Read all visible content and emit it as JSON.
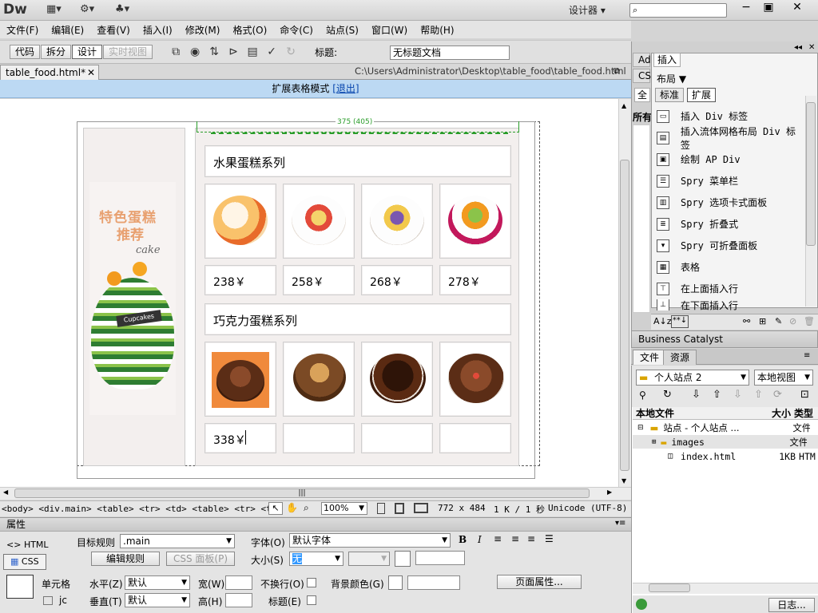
{
  "app": {
    "logo": "Dw",
    "workspace": "设计器",
    "window_buttons": [
      "−",
      "▣",
      "✕"
    ]
  },
  "menu": [
    "文件(F)",
    "编辑(E)",
    "查看(V)",
    "插入(I)",
    "修改(M)",
    "格式(O)",
    "命令(C)",
    "站点(S)",
    "窗口(W)",
    "帮助(H)"
  ],
  "toolbar": {
    "views": [
      "代码",
      "拆分",
      "设计",
      "实时视图"
    ],
    "title_label": "标题:",
    "title_value": "无标题文档"
  },
  "document": {
    "tab_name": "table_food.html*",
    "path": "C:\\Users\\Administrator\\Desktop\\table_food\\table_food.html",
    "expanded_mode_text": "扩展表格模式",
    "exit_link": "[退出]",
    "width_marker": "375 (405)"
  },
  "page": {
    "banner_line1": "特色蛋糕",
    "banner_line2": "推荐",
    "banner_en": "cake",
    "section1_title": "水果蛋糕系列",
    "section1_prices": [
      "238￥",
      "258￥",
      "268￥",
      "278￥"
    ],
    "section2_title": "巧克力蛋糕系列",
    "section2_prices": [
      "338￥",
      "",
      "",
      ""
    ],
    "cake_label": "Cupcakes"
  },
  "statusbar": {
    "tags": "<body> <div.main> <table> <tr> <td> <table> <tr> <td>",
    "zoom": "100%",
    "size": "772 x 484",
    "filesize": "1 K / 1 秒",
    "encoding": "Unicode (UTF-8)"
  },
  "properties": {
    "title": "属性",
    "html_label": "HTML",
    "css_label": "CSS",
    "target_rule_label": "目标规则",
    "target_rule_value": ".main",
    "edit_rule_btn": "编辑规则",
    "css_panel_btn": "CSS 面板(P)",
    "font_label": "字体(O)",
    "font_value": "默认字体",
    "size_label": "大小(S)",
    "size_value": "无",
    "bold": "B",
    "italic": "I",
    "cell_label": "单元格",
    "horiz_label": "水平(Z)",
    "horiz_value": "默认",
    "vert_label": "垂直(T)",
    "vert_value": "默认",
    "width_label": "宽(W)",
    "height_label": "高(H)",
    "nowrap_label": "不换行(O)",
    "header_label": "标题(E)",
    "bgcolor_label": "背景颜色(G)",
    "page_props_btn": "页面属性...",
    "jc": "jc"
  },
  "right_panel": {
    "side_tabs": [
      "Ad",
      "CS",
      "全",
      "所有"
    ],
    "insert_tab": "插入",
    "layout_label": "布局",
    "std_tab": "标准",
    "ext_tab": "扩展",
    "insert_items": [
      "插入 Div 标签",
      "插入流体网格布局 Div 标签",
      "绘制 AP Div",
      "Spry 菜单栏",
      "Spry 选项卡式面板",
      "Spry 折叠式",
      "Spry 可折叠面板",
      "表格",
      "在上面插入行",
      "在下面插入行"
    ],
    "business_catalyst": "Business Catalyst",
    "files_tab": "文件",
    "assets_tab": "资源",
    "site_select": "个人站点 2",
    "view_select": "本地视图",
    "col_local": "本地文件",
    "col_size": "大小",
    "col_type": "类型",
    "tree": [
      {
        "name": "站点 - 个人站点 ...",
        "size": "",
        "type": "文件"
      },
      {
        "name": "images",
        "size": "",
        "type": "文件"
      },
      {
        "name": "index.html",
        "size": "1KB",
        "type": "HTM"
      }
    ],
    "log_btn": "日志..."
  }
}
